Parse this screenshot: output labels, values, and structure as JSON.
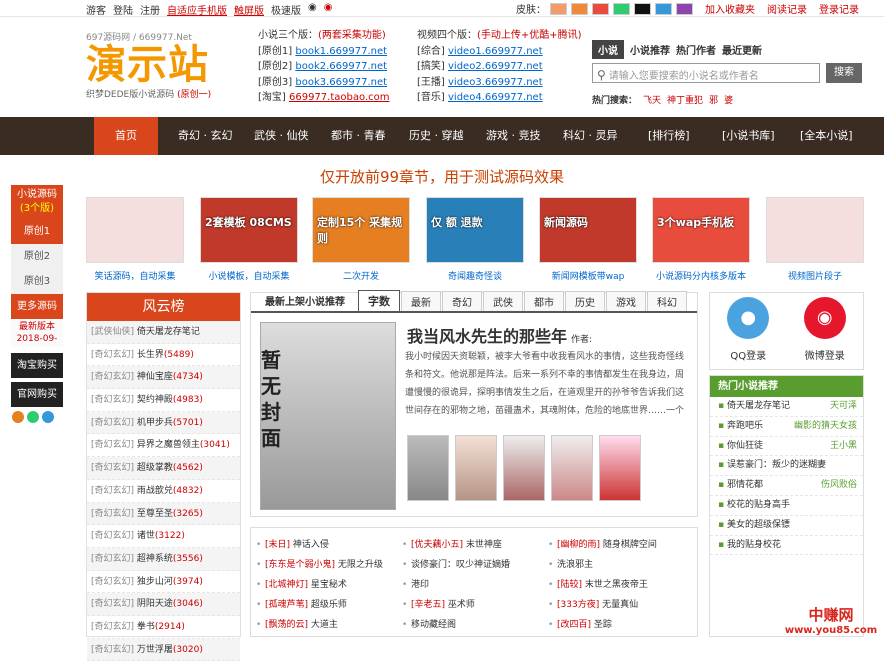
{
  "topbar": {
    "links": [
      "游客",
      "登陆",
      "注册"
    ],
    "red_link": "自适应手机版",
    "links2": [
      "触屏版",
      "极速版"
    ],
    "skin_label": "皮肤：",
    "skin_colors": [
      "#f39c6b",
      "#f08a3a",
      "#e74c3c",
      "#2ecc71",
      "#111111",
      "#3498db",
      "#8e44ad"
    ],
    "fav": "加入收藏夹",
    "history": "阅读记录",
    "site_note": "登录记录"
  },
  "logo": {
    "small": "697源码网 / 669977.Net",
    "big": "演示站",
    "sub": "织梦DEDE版小说源码",
    "sub_red": "(原创一)"
  },
  "novel_links": {
    "header": "小说三个版：",
    "header_red": "(两套采集功能)",
    "rows": [
      {
        "tag": "[原创1]",
        "url": "book1.669977.net"
      },
      {
        "tag": "[原创2]",
        "url": "book2.669977.net"
      },
      {
        "tag": "[原创3]",
        "url": "book3.669977.net"
      },
      {
        "tag": "[淘宝]",
        "url": "669977.taobao.com"
      }
    ]
  },
  "video_links": {
    "header": "视频四个版：",
    "header_red": "(手动上传+优酷+腾讯)",
    "rows": [
      {
        "tag": "[综合]",
        "url": "video1.669977.net"
      },
      {
        "tag": "[搞笑]",
        "url": "video2.669977.net"
      },
      {
        "tag": "[王播]",
        "url": "video3.669977.net"
      },
      {
        "tag": "[音乐]",
        "url": "video4.669977.net"
      }
    ]
  },
  "search": {
    "tabs": [
      "小说",
      "小说推荐",
      "热门作者",
      "最近更新"
    ],
    "placeholder": "请输入您要搜索的小说名或作者名",
    "button": "搜索",
    "hot_label": "热门搜索：",
    "hot_words": [
      "飞天",
      "神丁重犯",
      "邪",
      "婆"
    ]
  },
  "nav": {
    "items": [
      "首页",
      "奇幻 · 玄幻",
      "武侠 · 仙侠",
      "都市 · 青春",
      "历史 · 穿越",
      "游戏 · 竞技",
      "科幻 · 灵异",
      "[排行榜]",
      "[小说书库]",
      "[全本小说]"
    ]
  },
  "notice": "仅开放前99章节，用于测试源码效果",
  "leftcol": {
    "header": "小说源码",
    "header_sub": "(3个版)",
    "items": [
      "原创1",
      "原创2",
      "原创3"
    ],
    "more": "更多源码",
    "update": "最新版本",
    "update_date": "2018-09-",
    "buy1": "淘宝购买",
    "buy2": "官网购买",
    "icon_colors": [
      "#e67e22",
      "#2ecc71",
      "#3498db"
    ]
  },
  "gallery": [
    {
      "caption": "笑话源码，自动采集",
      "overlay": "",
      "color": "#f5dede"
    },
    {
      "caption": "小说模板，自动采集",
      "overlay": "2套模板 08CMS",
      "color": "#c0392b"
    },
    {
      "caption": "二次开发",
      "overlay": "定制15个 采集规则",
      "color": "#e67e22"
    },
    {
      "caption": "奇闻趣奇怪谈",
      "overlay": "仅 额 退款",
      "color": "#2980b9"
    },
    {
      "caption": "新闻网模板带wap",
      "overlay": "新闻源码",
      "color": "#c0392b"
    },
    {
      "caption": "小说源码分内核多版本",
      "overlay": "3个wap手机板",
      "color": "#e74c3c"
    },
    {
      "caption": "视频图片段子",
      "overlay": "",
      "color": "#f5dede"
    }
  ],
  "rank": {
    "title": "风云榜",
    "rows": [
      {
        "cat": "[武侠仙侠]",
        "name": "倚天屠龙存笔记",
        "n": ""
      },
      {
        "cat": "[奇幻玄幻]",
        "name": "长生界",
        "n": "(5489)"
      },
      {
        "cat": "[奇幻玄幻]",
        "name": "神仙宝座",
        "n": "(4734)"
      },
      {
        "cat": "[奇幻玄幻]",
        "name": "契约神殿",
        "n": "(4983)"
      },
      {
        "cat": "[奇幻玄幻]",
        "name": "机甲步兵",
        "n": "(5701)"
      },
      {
        "cat": "[奇幻玄幻]",
        "name": "异界之魔兽领主",
        "n": "(3041)"
      },
      {
        "cat": "[奇幻玄幻]",
        "name": "超级掌教",
        "n": "(4562)"
      },
      {
        "cat": "[奇幻玄幻]",
        "name": "雨战歆兑",
        "n": "(4832)"
      },
      {
        "cat": "[奇幻玄幻]",
        "name": "至尊至圣",
        "n": "(3265)"
      },
      {
        "cat": "[奇幻玄幻]",
        "name": "诸世",
        "n": "(3122)"
      },
      {
        "cat": "[奇幻玄幻]",
        "name": "超神系统",
        "n": "(3556)"
      },
      {
        "cat": "[奇幻玄幻]",
        "name": "独步山河",
        "n": "(3974)"
      },
      {
        "cat": "[奇幻玄幻]",
        "name": "阴阳天途",
        "n": "(3046)"
      },
      {
        "cat": "[奇幻玄幻]",
        "name": "拳书",
        "n": "(2914)"
      },
      {
        "cat": "[奇幻玄幻]",
        "name": "万世浮屠",
        "n": "(3020)"
      }
    ]
  },
  "center": {
    "tab_title": "最新上架小说推荐",
    "tabs": [
      "字数",
      "最新",
      "奇幻",
      "武侠",
      "都市",
      "历史",
      "游戏",
      "科幻"
    ],
    "cover_text": "暂无封面",
    "book_title": "我当风水先生的那些年",
    "author_label": "作者:",
    "desc": "我小时候因天资聪颖，被李大爷看中收我看风水的事情，这些我奇怪线条和符文。他说那是阵法。后来一系列不幸的事情都发生在我身边，周遭慢慢的很诡异，探明事情发生之后，在道观里开的孙爷爷告诉我们这世间存在的邪物之地，苗疆蛊术，其魂附体，危险的地底世界……一个个都让我九死一生。还有神秘"
  },
  "list": {
    "rows": [
      [
        {
          "tag": "[末日]",
          "name": "神话入侵"
        },
        {
          "tag": "[优夫藕小五]",
          "name": "末世神座"
        },
        {
          "tag": "[幽柳的雨]",
          "name": "随身棋牌空间"
        }
      ],
      [
        {
          "tag": "[东东是个弱小鬼]",
          "name": "无限之升级"
        },
        {
          "tag": "",
          "name": "谈修豪门：叹少神证嫡婚"
        },
        {
          "tag": "",
          "name": "洗浪邪主"
        }
      ],
      [
        {
          "tag": "[北城神灯]",
          "name": "星宝秘术"
        },
        {
          "tag": "",
          "name": "港印"
        },
        {
          "tag": "[陆较]",
          "name": "末世之黑夜帝王"
        }
      ],
      [
        {
          "tag": "[孤魂芦苇]",
          "name": "超级乐师"
        },
        {
          "tag": "[辛老五]",
          "name": "巫术师"
        },
        {
          "tag": "[333方夜]",
          "name": "无量真仙"
        }
      ],
      [
        {
          "tag": "[飘荡的云]",
          "name": "大道主"
        },
        {
          "tag": "",
          "name": "移动藏经阁"
        },
        {
          "tag": "[改四百]",
          "name": "圣踪"
        }
      ]
    ]
  },
  "social": {
    "qq_label": "QQ登录",
    "weibo_label": "微博登录"
  },
  "hotrec": {
    "title": "热门小说推荐",
    "rows": [
      {
        "name": "倚天屠龙存笔记",
        "author": "天可泽"
      },
      {
        "name": "奔跑吧乐",
        "author": "幽影的猜天女孩"
      },
      {
        "name": "你仙狂徒",
        "author": "王小黑"
      },
      {
        "name": "误惹豪门：叛少的迷糊妻",
        "author": ""
      },
      {
        "name": "邪情花都",
        "author": "伤风败俗"
      },
      {
        "name": "校花的贴身高手",
        "author": ""
      },
      {
        "name": "美女的超级保镖",
        "author": ""
      },
      {
        "name": "我的贴身校花",
        "author": ""
      }
    ]
  },
  "watermark": {
    "line1": "中赚网",
    "line2": "www.you85.com"
  }
}
